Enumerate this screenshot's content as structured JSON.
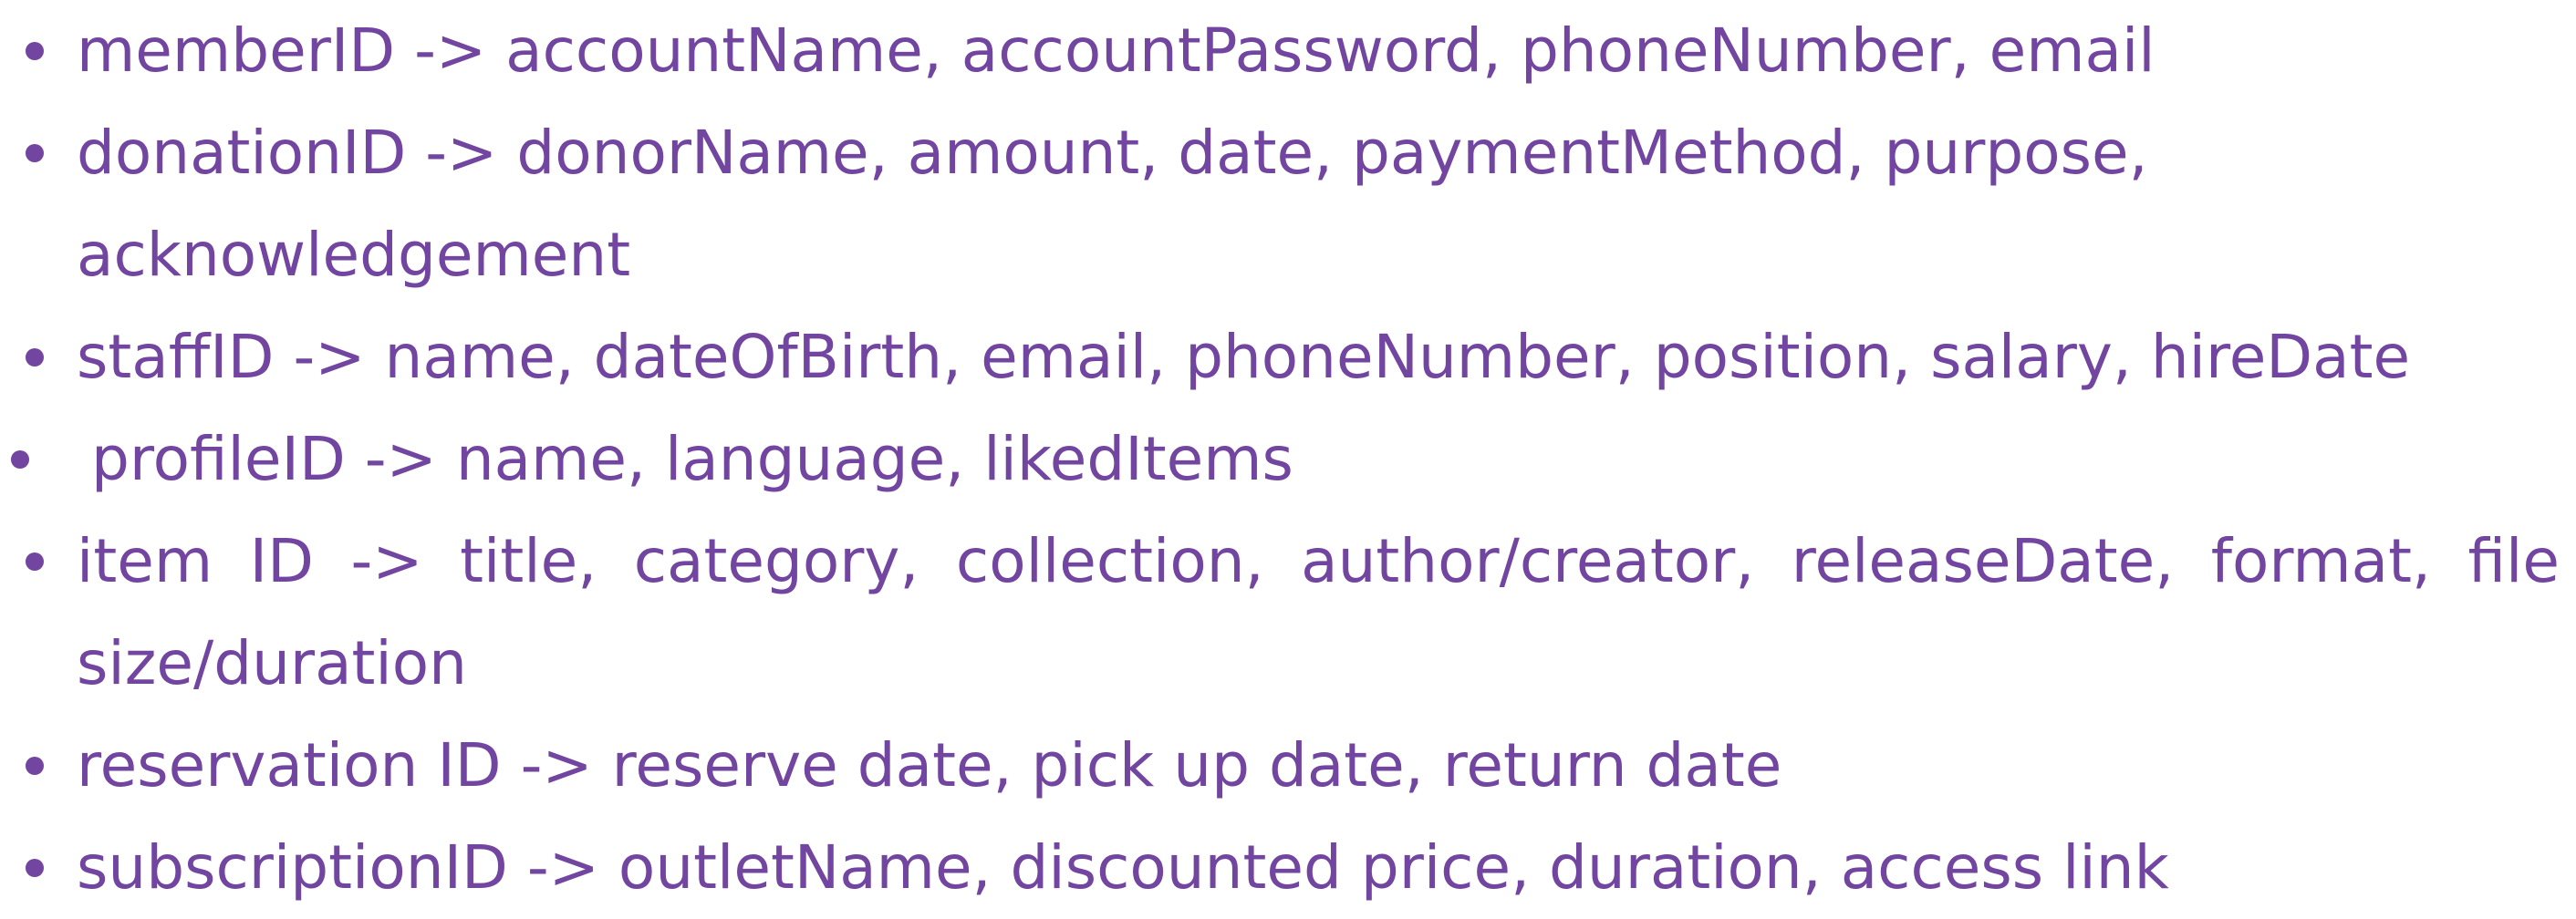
{
  "colors": {
    "text": "#7245a0",
    "background": "#ffffff"
  },
  "list": {
    "items": [
      {
        "text": "memberID -> accountName, accountPassword, phoneNumber, email"
      },
      {
        "text": "donationID -> donorName, amount, date, paymentMethod, purpose, acknowledgement"
      },
      {
        "text": "staffID -> name, dateOfBirth, email, phoneNumber, position, salary, hireDate"
      },
      {
        "text": "profileID -> name, language, likedItems"
      },
      {
        "text": "item ID -> title, category, collection, author/creator, releaseDate, format, file size/duration"
      },
      {
        "text": "reservation ID -> reserve date, pick up date, return date"
      },
      {
        "text": "subscriptionID -> outletName, discounted price, duration, access link"
      }
    ]
  }
}
